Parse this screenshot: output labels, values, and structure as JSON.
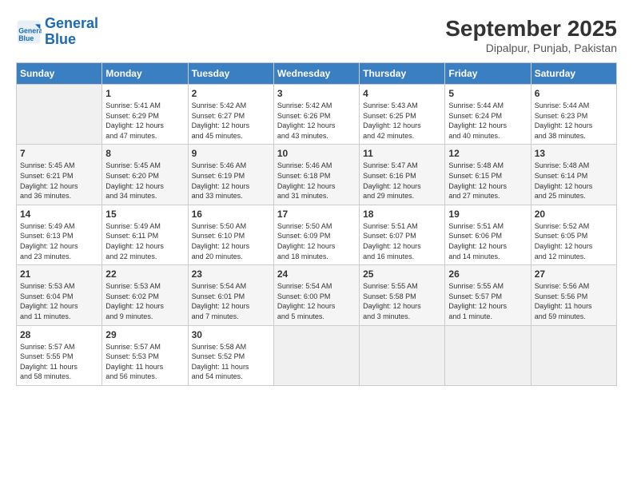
{
  "header": {
    "logo_line1": "General",
    "logo_line2": "Blue",
    "month": "September 2025",
    "location": "Dipalpur, Punjab, Pakistan"
  },
  "weekdays": [
    "Sunday",
    "Monday",
    "Tuesday",
    "Wednesday",
    "Thursday",
    "Friday",
    "Saturday"
  ],
  "weeks": [
    [
      {
        "day": "",
        "info": ""
      },
      {
        "day": "1",
        "info": "Sunrise: 5:41 AM\nSunset: 6:29 PM\nDaylight: 12 hours\nand 47 minutes."
      },
      {
        "day": "2",
        "info": "Sunrise: 5:42 AM\nSunset: 6:27 PM\nDaylight: 12 hours\nand 45 minutes."
      },
      {
        "day": "3",
        "info": "Sunrise: 5:42 AM\nSunset: 6:26 PM\nDaylight: 12 hours\nand 43 minutes."
      },
      {
        "day": "4",
        "info": "Sunrise: 5:43 AM\nSunset: 6:25 PM\nDaylight: 12 hours\nand 42 minutes."
      },
      {
        "day": "5",
        "info": "Sunrise: 5:44 AM\nSunset: 6:24 PM\nDaylight: 12 hours\nand 40 minutes."
      },
      {
        "day": "6",
        "info": "Sunrise: 5:44 AM\nSunset: 6:23 PM\nDaylight: 12 hours\nand 38 minutes."
      }
    ],
    [
      {
        "day": "7",
        "info": "Sunrise: 5:45 AM\nSunset: 6:21 PM\nDaylight: 12 hours\nand 36 minutes."
      },
      {
        "day": "8",
        "info": "Sunrise: 5:45 AM\nSunset: 6:20 PM\nDaylight: 12 hours\nand 34 minutes."
      },
      {
        "day": "9",
        "info": "Sunrise: 5:46 AM\nSunset: 6:19 PM\nDaylight: 12 hours\nand 33 minutes."
      },
      {
        "day": "10",
        "info": "Sunrise: 5:46 AM\nSunset: 6:18 PM\nDaylight: 12 hours\nand 31 minutes."
      },
      {
        "day": "11",
        "info": "Sunrise: 5:47 AM\nSunset: 6:16 PM\nDaylight: 12 hours\nand 29 minutes."
      },
      {
        "day": "12",
        "info": "Sunrise: 5:48 AM\nSunset: 6:15 PM\nDaylight: 12 hours\nand 27 minutes."
      },
      {
        "day": "13",
        "info": "Sunrise: 5:48 AM\nSunset: 6:14 PM\nDaylight: 12 hours\nand 25 minutes."
      }
    ],
    [
      {
        "day": "14",
        "info": "Sunrise: 5:49 AM\nSunset: 6:13 PM\nDaylight: 12 hours\nand 23 minutes."
      },
      {
        "day": "15",
        "info": "Sunrise: 5:49 AM\nSunset: 6:11 PM\nDaylight: 12 hours\nand 22 minutes."
      },
      {
        "day": "16",
        "info": "Sunrise: 5:50 AM\nSunset: 6:10 PM\nDaylight: 12 hours\nand 20 minutes."
      },
      {
        "day": "17",
        "info": "Sunrise: 5:50 AM\nSunset: 6:09 PM\nDaylight: 12 hours\nand 18 minutes."
      },
      {
        "day": "18",
        "info": "Sunrise: 5:51 AM\nSunset: 6:07 PM\nDaylight: 12 hours\nand 16 minutes."
      },
      {
        "day": "19",
        "info": "Sunrise: 5:51 AM\nSunset: 6:06 PM\nDaylight: 12 hours\nand 14 minutes."
      },
      {
        "day": "20",
        "info": "Sunrise: 5:52 AM\nSunset: 6:05 PM\nDaylight: 12 hours\nand 12 minutes."
      }
    ],
    [
      {
        "day": "21",
        "info": "Sunrise: 5:53 AM\nSunset: 6:04 PM\nDaylight: 12 hours\nand 11 minutes."
      },
      {
        "day": "22",
        "info": "Sunrise: 5:53 AM\nSunset: 6:02 PM\nDaylight: 12 hours\nand 9 minutes."
      },
      {
        "day": "23",
        "info": "Sunrise: 5:54 AM\nSunset: 6:01 PM\nDaylight: 12 hours\nand 7 minutes."
      },
      {
        "day": "24",
        "info": "Sunrise: 5:54 AM\nSunset: 6:00 PM\nDaylight: 12 hours\nand 5 minutes."
      },
      {
        "day": "25",
        "info": "Sunrise: 5:55 AM\nSunset: 5:58 PM\nDaylight: 12 hours\nand 3 minutes."
      },
      {
        "day": "26",
        "info": "Sunrise: 5:55 AM\nSunset: 5:57 PM\nDaylight: 12 hours\nand 1 minute."
      },
      {
        "day": "27",
        "info": "Sunrise: 5:56 AM\nSunset: 5:56 PM\nDaylight: 11 hours\nand 59 minutes."
      }
    ],
    [
      {
        "day": "28",
        "info": "Sunrise: 5:57 AM\nSunset: 5:55 PM\nDaylight: 11 hours\nand 58 minutes."
      },
      {
        "day": "29",
        "info": "Sunrise: 5:57 AM\nSunset: 5:53 PM\nDaylight: 11 hours\nand 56 minutes."
      },
      {
        "day": "30",
        "info": "Sunrise: 5:58 AM\nSunset: 5:52 PM\nDaylight: 11 hours\nand 54 minutes."
      },
      {
        "day": "",
        "info": ""
      },
      {
        "day": "",
        "info": ""
      },
      {
        "day": "",
        "info": ""
      },
      {
        "day": "",
        "info": ""
      }
    ]
  ]
}
